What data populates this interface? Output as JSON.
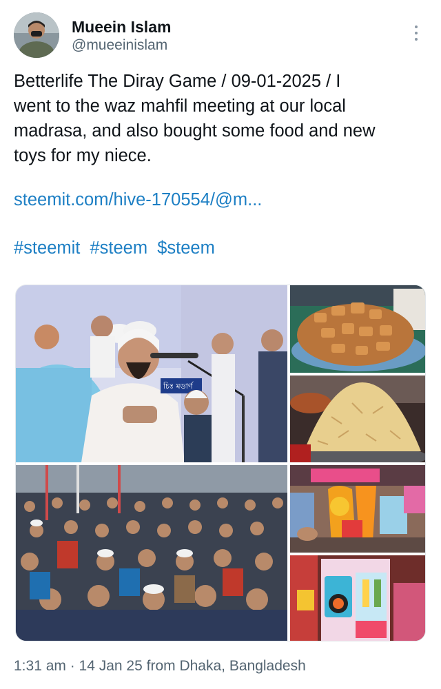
{
  "user": {
    "display_name": "Mueein Islam",
    "handle": "@mueeinislam"
  },
  "tweet": {
    "text_lines": [
      "Betterlife The Diray Game / 09-01-2025 / I",
      "went to the waz mahfil meeting at our local",
      "madrasa, and also bought some food and new",
      "toys for my niece."
    ],
    "link": "steemit.com/hive-170554/@m...",
    "tags": [
      "#steemit",
      "#steem",
      "$steem"
    ]
  },
  "photos": {
    "banner_sign": "চিঃ মডার্ণ"
  },
  "footer": {
    "meta": "1:31 am · 14 Jan 25 from Dhaka, Bangladesh"
  },
  "icons": {
    "more": "more-vertical-icon"
  },
  "colors": {
    "link": "#1d7fc4",
    "secondary_text": "#536471",
    "primary_text": "#0f1419"
  }
}
